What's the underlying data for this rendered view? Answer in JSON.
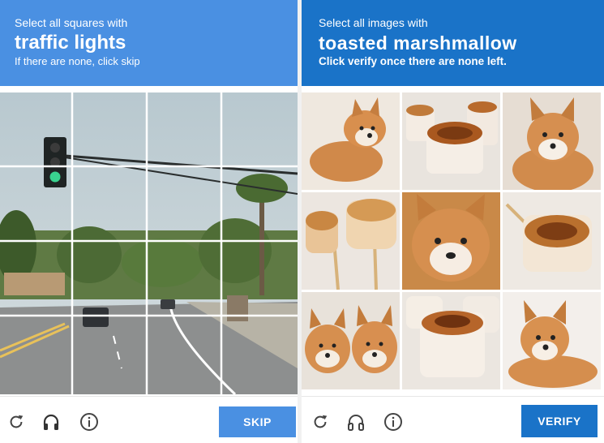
{
  "left": {
    "instruction_small": "Select all squares with",
    "instruction_big": "traffic lights",
    "instruction_sub": "If there are none, click skip",
    "button_label": "SKIP",
    "reload_icon": "reload-icon",
    "audio_icon": "headphones-icon",
    "info_icon": "info-icon"
  },
  "right": {
    "instruction_small": "Select all images with",
    "instruction_big": "toasted marshmallow",
    "instruction_sub": "Click verify once there are none left.",
    "button_label": "VERIFY",
    "tiles": [
      "shiba dog",
      "toasted marshmallow",
      "shiba dog",
      "toasted marshmallows on sticks",
      "shiba dog face",
      "toasted marshmallow on stick",
      "two shiba dogs",
      "toasted marshmallow",
      "shiba dog"
    ]
  },
  "colors": {
    "left_accent": "#4a90e2",
    "right_accent": "#1a73c8"
  }
}
